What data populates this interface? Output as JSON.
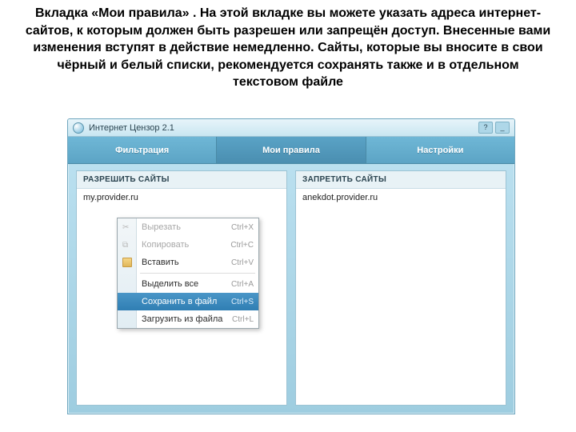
{
  "heading": "Вкладка «Мои правила» .\nНа этой вкладке вы можете указать адреса интернет-сайтов, к которым должен быть разрешен или запрещён доступ. Внесенные вами изменения вступят в действие немедленно. Сайты, которые вы вносите в свои чёрный и белый списки, рекомендуется сохранять также и в отдельном текстовом файле",
  "window": {
    "title": "Интернет Цензор 2.1",
    "help_btn": "?",
    "min_btn": "_"
  },
  "tabs": {
    "filter": "Фильтрация",
    "rules": "Мои правила",
    "settings": "Настройки"
  },
  "panels": {
    "allow_header": "РАЗРЕШИТЬ САЙТЫ",
    "deny_header": "ЗАПРЕТИТЬ САЙТЫ",
    "allow_entry": "my.provider.ru",
    "deny_entry": "anekdot.provider.ru"
  },
  "menu": {
    "cut": {
      "label": "Вырезать",
      "shortcut": "Ctrl+X"
    },
    "copy": {
      "label": "Копировать",
      "shortcut": "Ctrl+C"
    },
    "paste": {
      "label": "Вставить",
      "shortcut": "Ctrl+V"
    },
    "select_all": {
      "label": "Выделить все",
      "shortcut": "Ctrl+A"
    },
    "save_file": {
      "label": "Сохранить в файл",
      "shortcut": "Ctrl+S"
    },
    "load_file": {
      "label": "Загрузить из файла",
      "shortcut": "Ctrl+L"
    }
  }
}
